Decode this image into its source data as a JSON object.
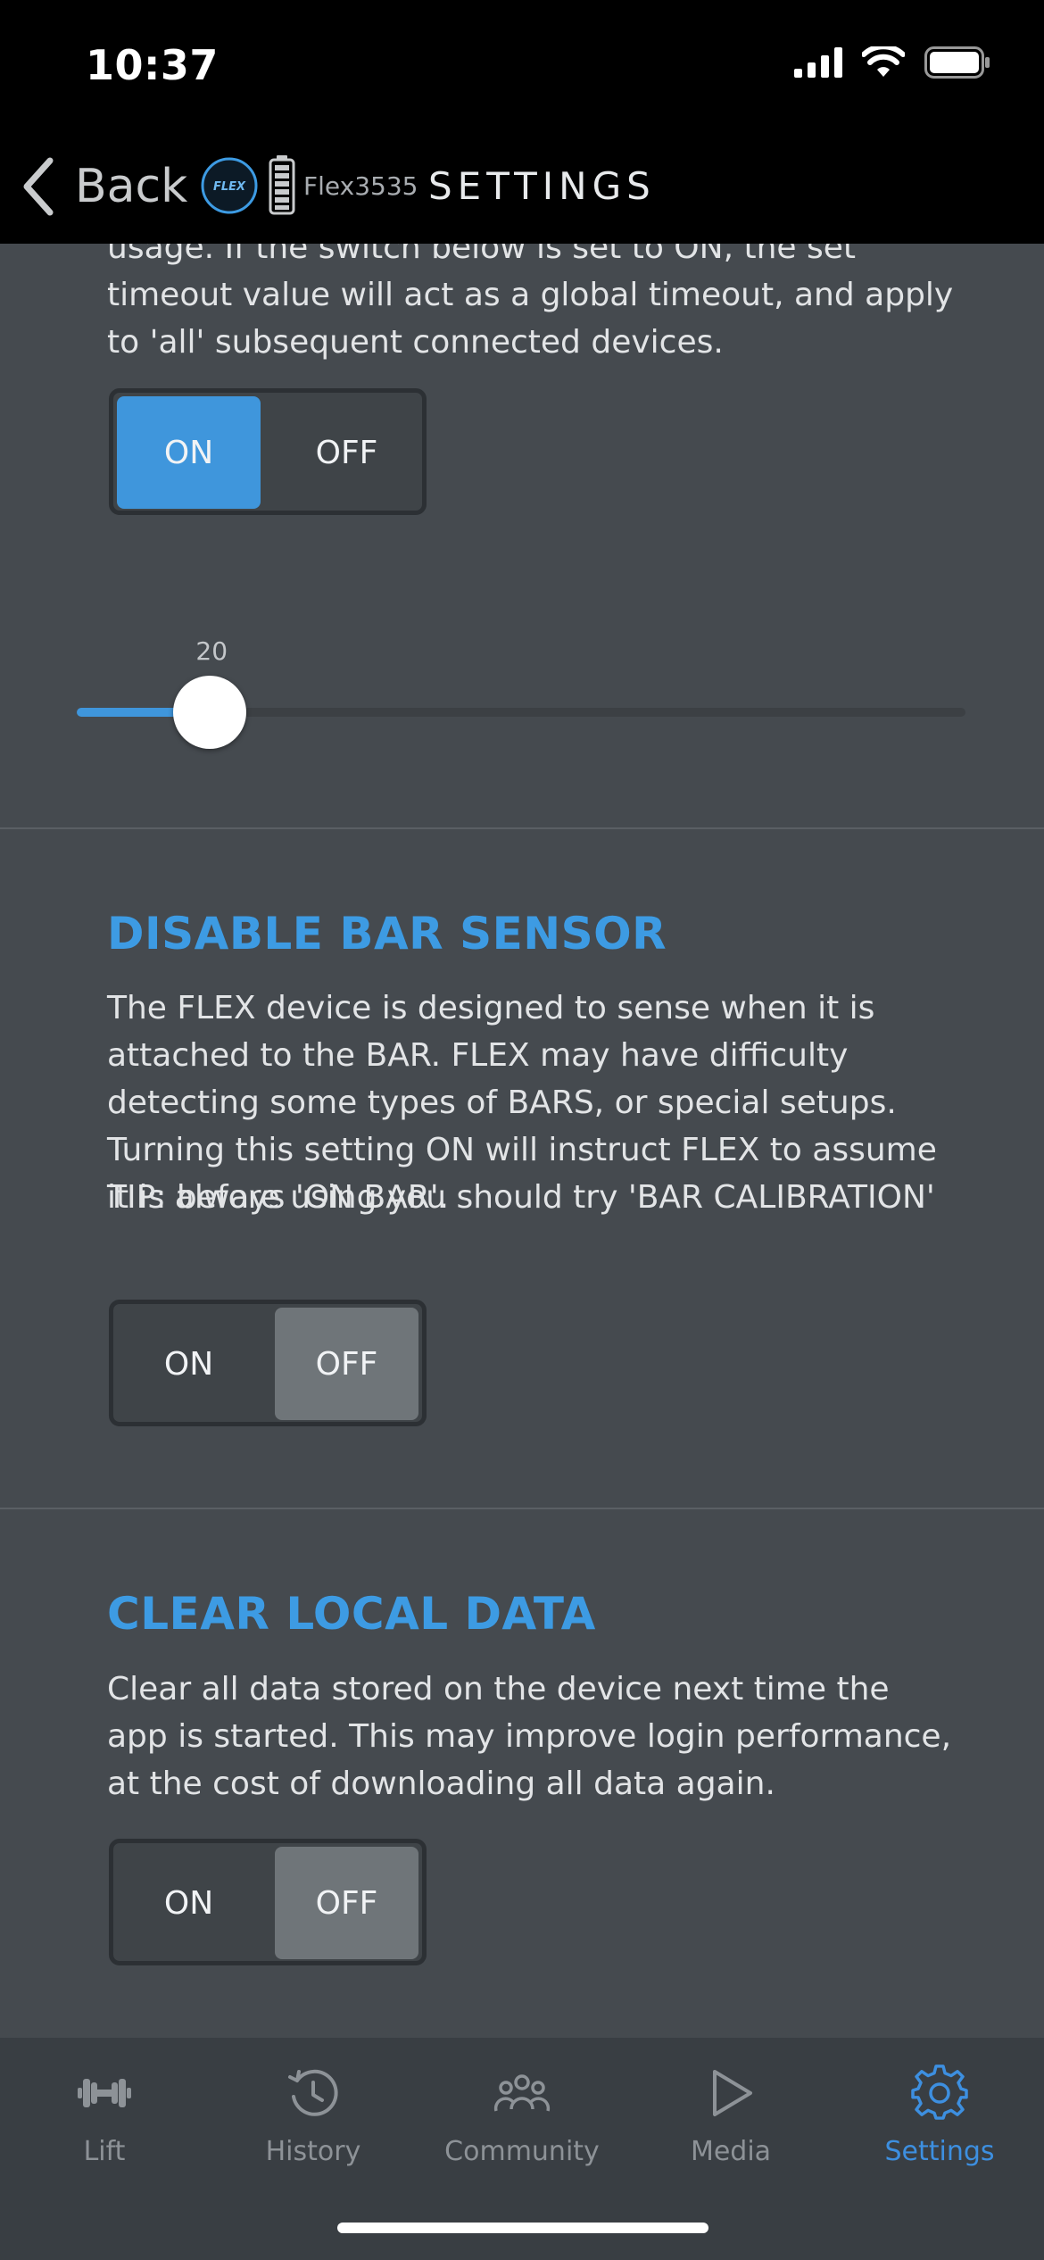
{
  "status_bar": {
    "time": "10:37"
  },
  "nav": {
    "back_label": "Back",
    "logo_text": "FLEX",
    "device_name": "Flex3535",
    "title": "SETTINGS"
  },
  "timeout": {
    "description": "usage. If the switch below is set to ON, the set timeout value will act as a global timeout, and apply to 'all' subsequent connected devices.",
    "toggle": {
      "on_label": "ON",
      "off_label": "OFF",
      "selected": "ON"
    },
    "slider": {
      "value": "20",
      "fraction": 0.15
    }
  },
  "disable_bar_sensor": {
    "title": "DISABLE BAR SENSOR",
    "description": "The FLEX device is designed to sense when it is attached to the BAR. FLEX may have difficulty detecting some types of BARS, or special setups.  Turning this setting ON will instruct FLEX to assume it is always 'ON BAR'.",
    "tip": "TIP: before using you should try 'BAR CALIBRATION'",
    "toggle": {
      "on_label": "ON",
      "off_label": "OFF",
      "selected": "OFF"
    }
  },
  "clear_local_data": {
    "title": "CLEAR LOCAL DATA",
    "description": "Clear all data stored on the device next time the app is started. This may improve login performance, at the cost of downloading all data again.",
    "toggle": {
      "on_label": "ON",
      "off_label": "OFF",
      "selected": "OFF"
    }
  },
  "tabs": [
    {
      "label": "Lift",
      "icon": "dumbbell-icon"
    },
    {
      "label": "History",
      "icon": "history-icon"
    },
    {
      "label": "Community",
      "icon": "community-icon"
    },
    {
      "label": "Media",
      "icon": "play-icon"
    },
    {
      "label": "Settings",
      "icon": "gear-icon",
      "active": true
    }
  ],
  "colors": {
    "accent": "#3d9be3",
    "toggle_on": "#3f96dc",
    "toggle_off_selected": "#6f7579",
    "background": "#454a4f",
    "tab_active": "#3d8fe0"
  }
}
